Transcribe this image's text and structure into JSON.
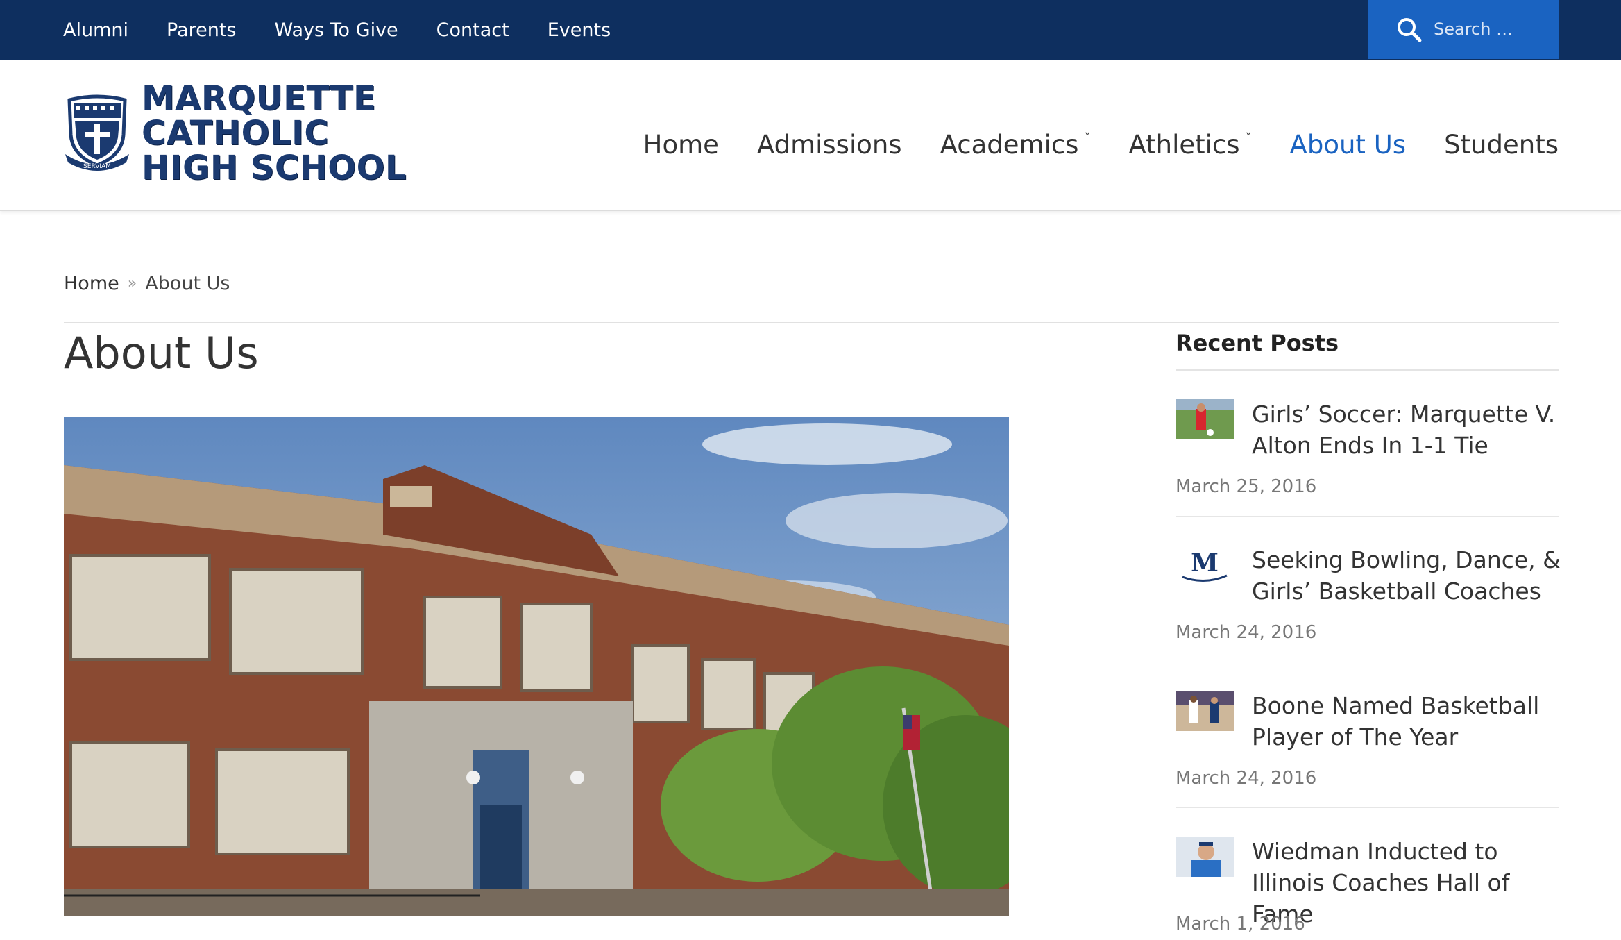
{
  "topnav": {
    "items": [
      "Alumni",
      "Parents",
      "Ways To Give",
      "Contact",
      "Events"
    ]
  },
  "search": {
    "placeholder": "Search …",
    "icon": "search-icon"
  },
  "logo": {
    "lines": [
      "MARQUETTE",
      "CATHOLIC",
      "HIGH SCHOOL"
    ],
    "crest_motto": "SERVIAM"
  },
  "mainnav": {
    "items": [
      {
        "label": "Home",
        "dropdown": false,
        "active": false
      },
      {
        "label": "Admissions",
        "dropdown": false,
        "active": false
      },
      {
        "label": "Academics",
        "dropdown": true,
        "active": false
      },
      {
        "label": "Athletics",
        "dropdown": true,
        "active": false
      },
      {
        "label": "About Us",
        "dropdown": false,
        "active": true
      },
      {
        "label": "Students",
        "dropdown": false,
        "active": false
      }
    ]
  },
  "breadcrumb": {
    "home": "Home",
    "separator": "»",
    "current": "About Us"
  },
  "page": {
    "title": "About Us"
  },
  "sidebar": {
    "heading": "Recent Posts",
    "posts": [
      {
        "title": "Girls’ Soccer: Marquette V. Alton Ends In 1-1 Tie",
        "date": "March 25, 2016"
      },
      {
        "title": "Seeking Bowling, Dance, & Girls’ Basketball Coaches",
        "date": "March 24, 2016"
      },
      {
        "title": "Boone Named Basketball Player of The Year",
        "date": "March 24, 2016"
      },
      {
        "title": "Wiedman Inducted to Illinois Coaches Hall of Fame",
        "date": "March 1, 2016"
      }
    ]
  },
  "colors": {
    "topbar": "#0e2f5f",
    "accent": "#1a63c1",
    "logo": "#1b3a70"
  }
}
